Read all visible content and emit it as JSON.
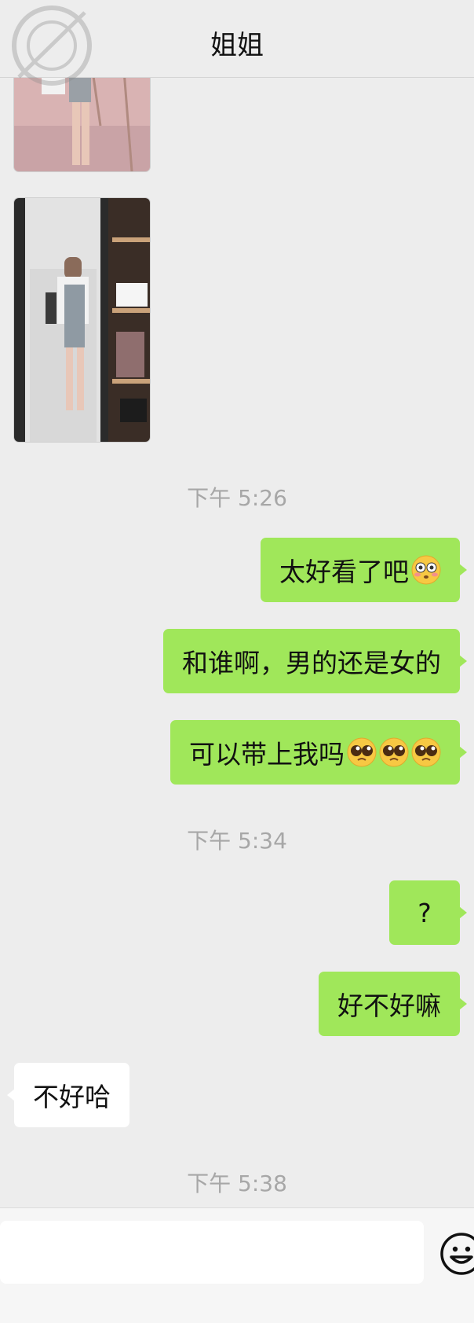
{
  "header": {
    "title": "姐姐",
    "watermark_icon": "watermark-logo"
  },
  "messages": {
    "time1": "下午 5:26",
    "out1": "太好看了吧",
    "out1_emoji": "flushed-face",
    "out2": "和谁啊，男的还是女的",
    "out3": "可以带上我吗",
    "out3_emoji": "pleading-face",
    "time2": "下午 5:34",
    "out4": "?",
    "out5": "好不好嘛",
    "in1": "不好哈",
    "time3": "下午 5:38"
  },
  "input": {
    "placeholder": "",
    "emoji_icon": "smiley-icon"
  },
  "colors": {
    "background": "#ededed",
    "outgoing_bubble": "#a0e75a",
    "incoming_bubble": "#ffffff",
    "timestamp": "#a7a7a7"
  }
}
